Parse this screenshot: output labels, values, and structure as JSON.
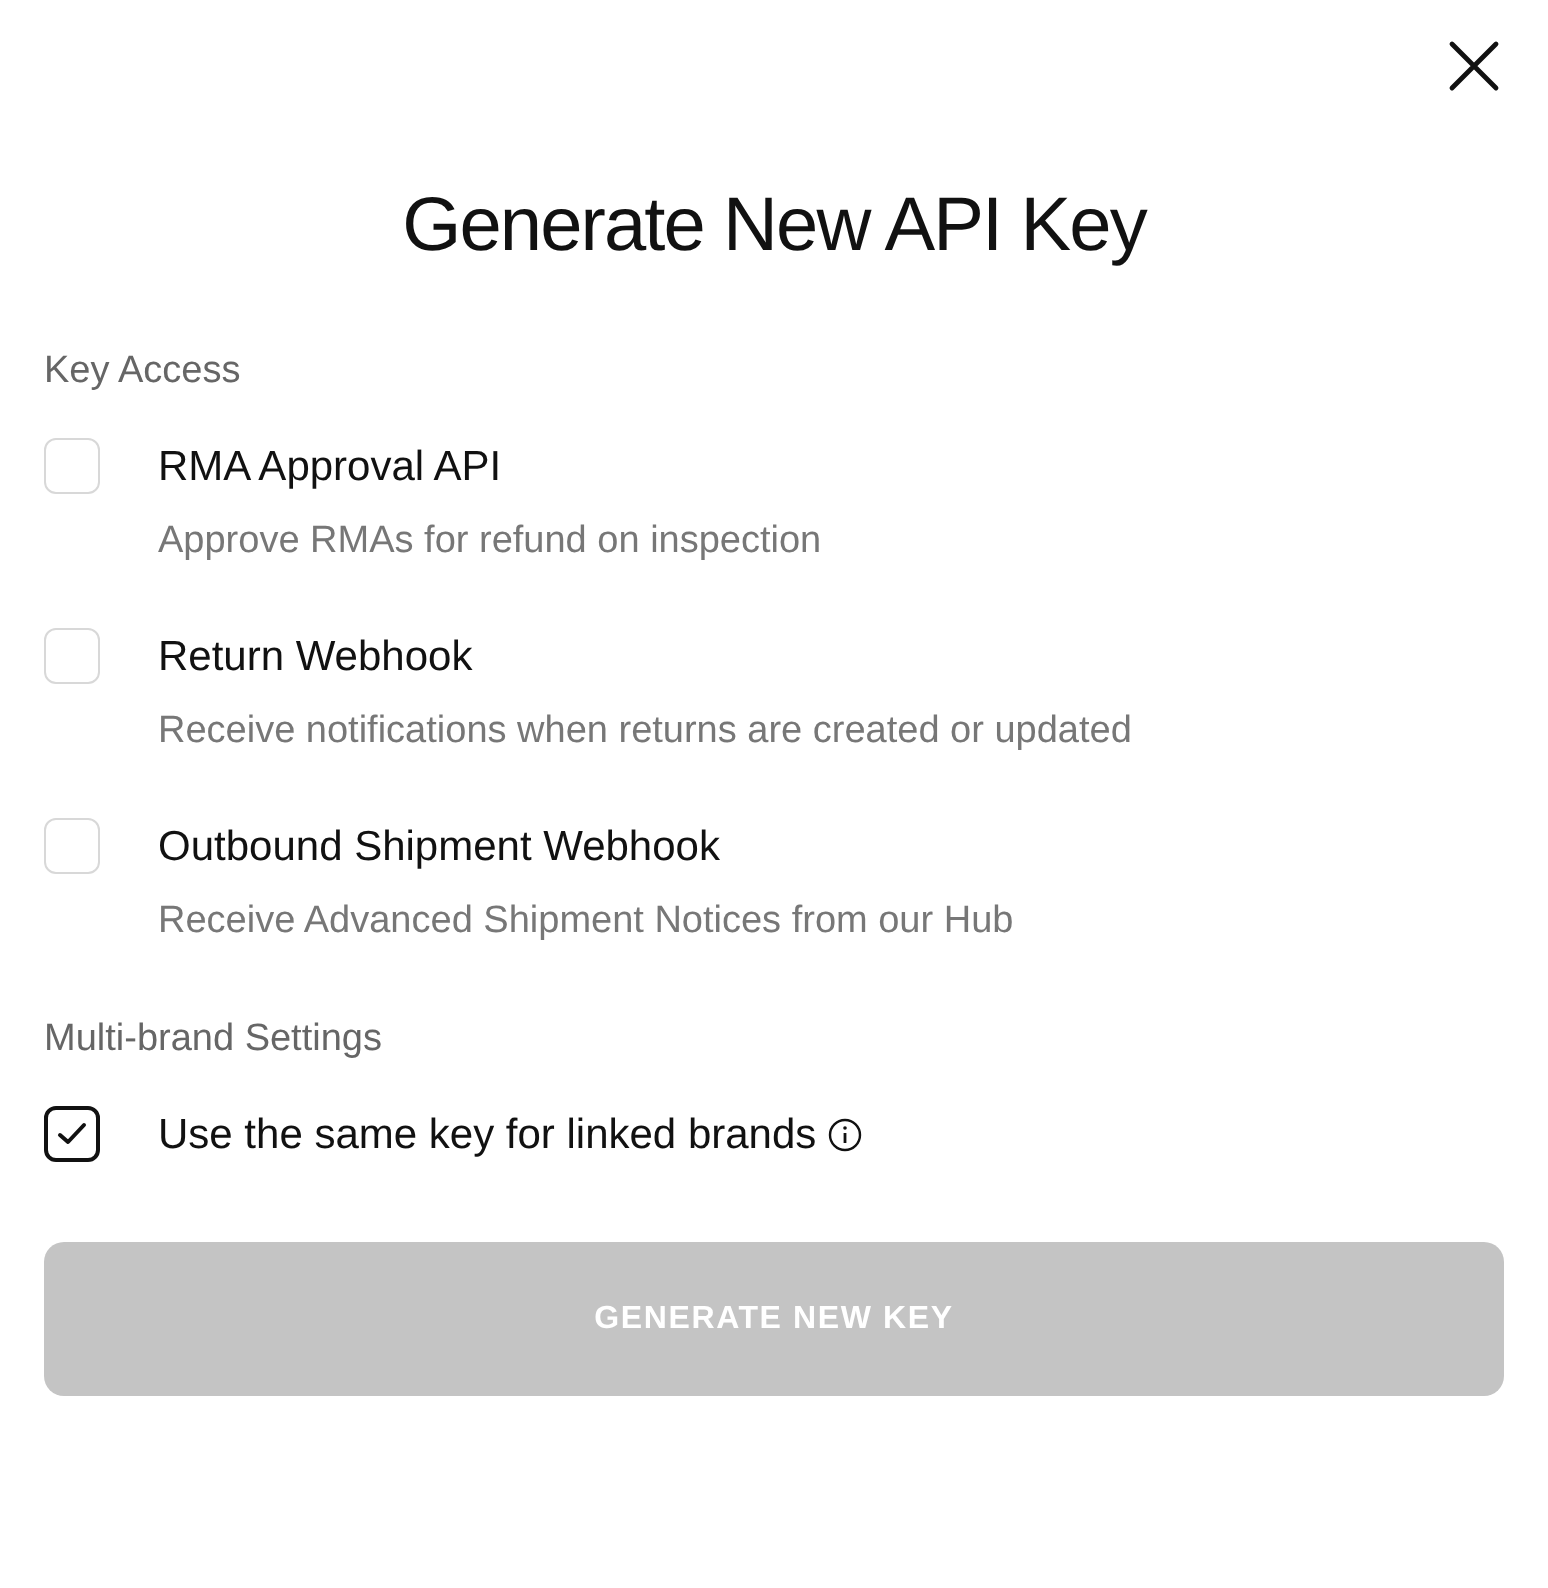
{
  "dialog": {
    "title": "Generate New API Key"
  },
  "sections": [
    {
      "heading": "Key Access",
      "options": [
        {
          "label": "RMA Approval API",
          "description": "Approve RMAs for refund on inspection",
          "checked": false,
          "info": false
        },
        {
          "label": "Return Webhook",
          "description": "Receive notifications when returns are created or updated",
          "checked": false,
          "info": false
        },
        {
          "label": "Outbound Shipment Webhook",
          "description": "Receive Advanced Shipment Notices from our Hub",
          "checked": false,
          "info": false
        }
      ]
    },
    {
      "heading": "Multi-brand Settings",
      "options": [
        {
          "label": "Use the same key for linked brands",
          "checked": true,
          "info": true
        }
      ]
    }
  ],
  "button": {
    "label": "GENERATE NEW KEY",
    "disabled": true
  }
}
